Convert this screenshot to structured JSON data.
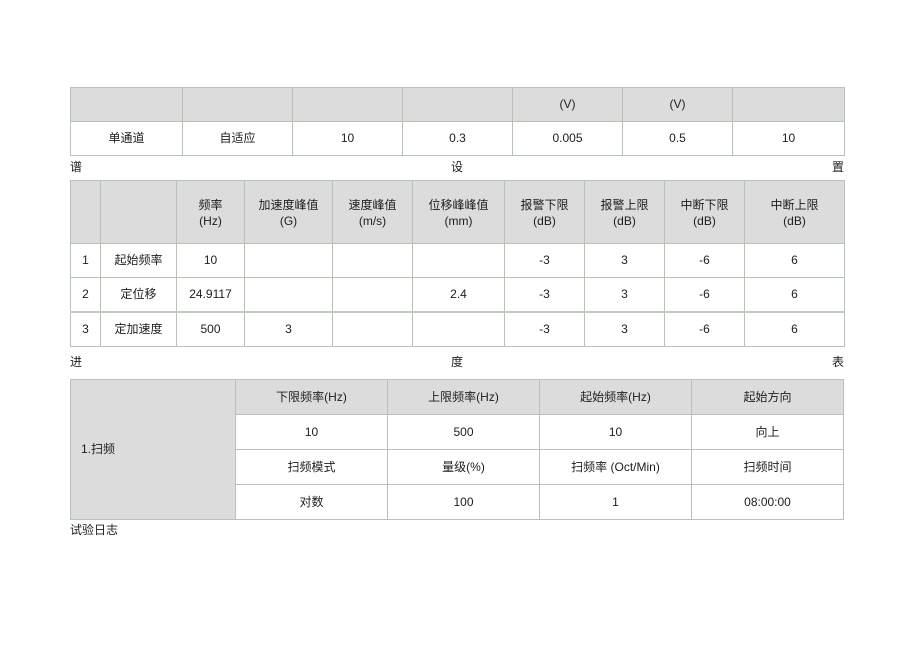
{
  "document": {
    "background_color": "#ffffff",
    "header_fill": "#dcdcdc",
    "border_color": "#b9c2b9"
  },
  "spectrum_table": {
    "name": "spectrum-settings-table",
    "header": [
      "",
      "",
      "",
      "",
      "(V)",
      "(V)",
      ""
    ],
    "values": [
      "单通道",
      "自适应",
      "10",
      "0.3",
      "0.005",
      "0.5",
      "10"
    ]
  },
  "spectrum_caption": {
    "left": "谱",
    "center": "设",
    "right": "置"
  },
  "progress_table": {
    "name": "progress-table",
    "columns": [
      {
        "name": "",
        "unit": ""
      },
      {
        "name": "",
        "unit": ""
      },
      {
        "name": "频率",
        "unit": "(Hz)"
      },
      {
        "name": "加速度峰值",
        "unit": "(G)"
      },
      {
        "name": "速度峰值",
        "unit": "(m/s)"
      },
      {
        "name": "位移峰峰值",
        "unit": "(mm)"
      },
      {
        "name": "报警下限",
        "unit": "(dB)"
      },
      {
        "name": "报警上限",
        "unit": "(dB)"
      },
      {
        "name": "中断下限",
        "unit": "(dB)"
      },
      {
        "name": "中断上限",
        "unit": "(dB)"
      }
    ],
    "rows": [
      {
        "index": "1",
        "label": "起始频率",
        "freq": "10",
        "accel": "",
        "vel": "",
        "disp": "",
        "warn_low": "-3",
        "warn_high": "3",
        "abort_low": "-6",
        "abort_high": "6"
      },
      {
        "index": "2",
        "label": "定位移",
        "freq": "24.9117",
        "accel": "",
        "vel": "",
        "disp": "2.4",
        "warn_low": "-3",
        "warn_high": "3",
        "abort_low": "-6",
        "abort_high": "6"
      },
      {
        "index": "3",
        "label": "定加速度",
        "freq": "500",
        "accel": "3",
        "vel": "",
        "disp": "",
        "warn_low": "-3",
        "warn_high": "3",
        "abort_low": "-6",
        "abort_high": "6"
      }
    ]
  },
  "progress_caption": {
    "left": "进",
    "center": "度",
    "right": "表"
  },
  "sweep_table": {
    "name": "sweep-table",
    "row_label": "1.扫频",
    "header_row": [
      "下限频率(Hz)",
      "上限频率(Hz)",
      "起始频率(Hz)",
      "起始方向"
    ],
    "value_row_1": [
      "10",
      "500",
      "10",
      "向上"
    ],
    "subheader_row": [
      "扫频模式",
      "量级(%)",
      "扫频率 (Oct/Min)",
      "扫频时间"
    ],
    "value_row_2": [
      "对数",
      "100",
      "1",
      "08:00:00"
    ]
  },
  "footer": {
    "label": "试验日志"
  }
}
